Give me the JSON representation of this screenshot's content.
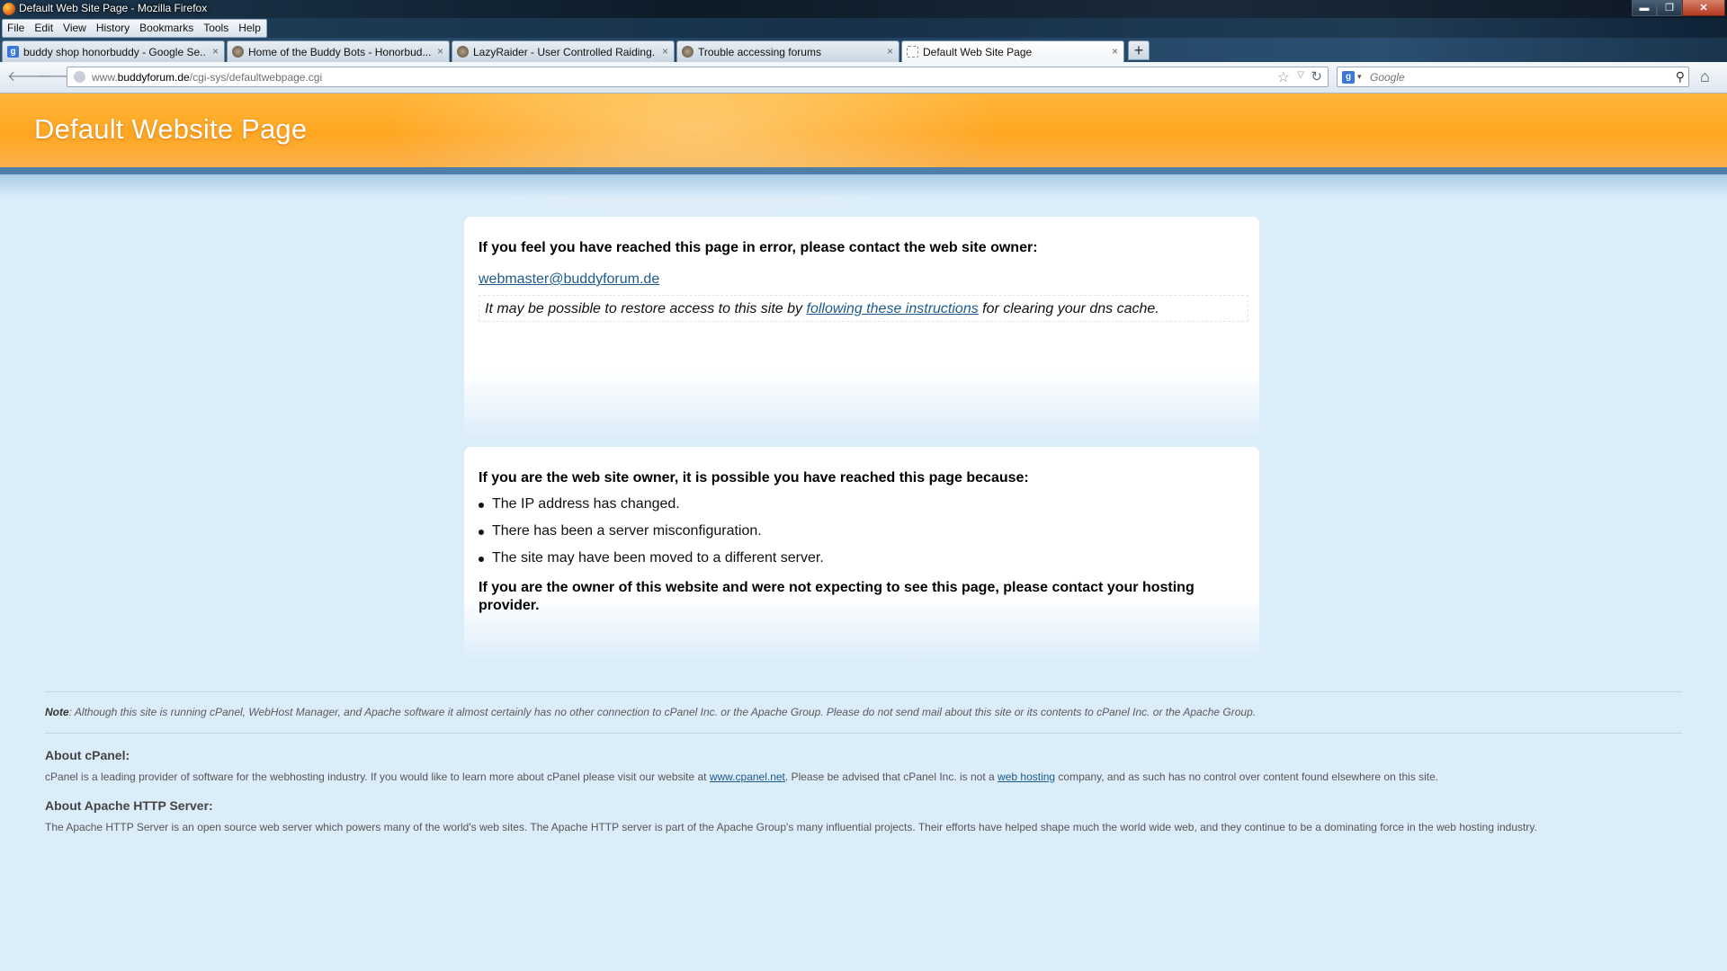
{
  "window": {
    "title": "Default Web Site Page - Mozilla Firefox",
    "controls": {
      "minimize": "▬",
      "maximize": "❐",
      "close": "✕"
    }
  },
  "menubar": {
    "items": [
      "File",
      "Edit",
      "View",
      "History",
      "Bookmarks",
      "Tools",
      "Help"
    ]
  },
  "tabs": [
    {
      "label": "buddy shop honorbuddy - Google Se...",
      "icon": "google-icon",
      "close": "×"
    },
    {
      "label": "Home of the Buddy Bots - Honorbud...",
      "icon": "honorbuddy-icon",
      "close": "×"
    },
    {
      "label": "LazyRaider - User Controlled Raiding...",
      "icon": "honorbuddy-icon",
      "close": "×"
    },
    {
      "label": "Trouble accessing forums",
      "icon": "honorbuddy-icon",
      "close": "×"
    },
    {
      "label": "Default Web Site Page",
      "icon": "blank-page-icon",
      "close": "×",
      "active": true
    }
  ],
  "new_tab": "+",
  "navigation": {
    "back": "🡐",
    "forward": "🡒",
    "url_prefix": "www.",
    "url_domain": "buddyforum.de",
    "url_path": "/cgi-sys/defaultwebpage.cgi",
    "bookmark_star": "☆",
    "history_drop": "▽",
    "reload": "↻",
    "search_engine_letter": "g",
    "search_engine_drop": "▾",
    "search_placeholder": "Google",
    "search_button": "⚲",
    "home": "⌂"
  },
  "page": {
    "banner_title": "Default Website Page",
    "error_box": {
      "heading": "If you feel you have reached this page in error, please contact the web site owner:",
      "email": "webmaster@buddyforum.de",
      "dns_text_before": "It may be possible to restore access to this site by ",
      "dns_link": "following these instructions",
      "dns_text_after": " for clearing your dns cache."
    },
    "owner_box": {
      "heading": "If you are the web site owner, it is possible you have reached this page because:",
      "reasons": [
        "The IP address has changed.",
        "There has been a server misconfiguration.",
        "The site may have been moved to a different server."
      ],
      "final": "If you are the owner of this website and were not expecting to see this page, please contact your hosting provider."
    },
    "note_label": "Note",
    "note_text": ": Although this site is running cPanel, WebHost Manager, and Apache software it almost certainly has no other connection to cPanel Inc. or the Apache Group. Please do not send mail about this site or its contents to cPanel Inc. or the Apache Group.",
    "about_cpanel": {
      "heading": "About cPanel:",
      "text_before": "cPanel is a leading provider of software for the webhosting industry. If you would like to learn more about cPanel please visit our website at ",
      "link1": "www.cpanel.net",
      "text_middle": ". Please be advised that cPanel Inc. is not a ",
      "link2": "web hosting",
      "text_after": " company, and as such has no control over content found elsewhere on this site."
    },
    "about_apache": {
      "heading": "About Apache HTTP Server:",
      "text": "The Apache HTTP Server is an open source web server which powers many of the world's web sites. The Apache HTTP server is part of the Apache Group's many influential projects. Their efforts have helped shape much the world wide web, and they continue to be a dominating force in the web hosting industry."
    }
  }
}
